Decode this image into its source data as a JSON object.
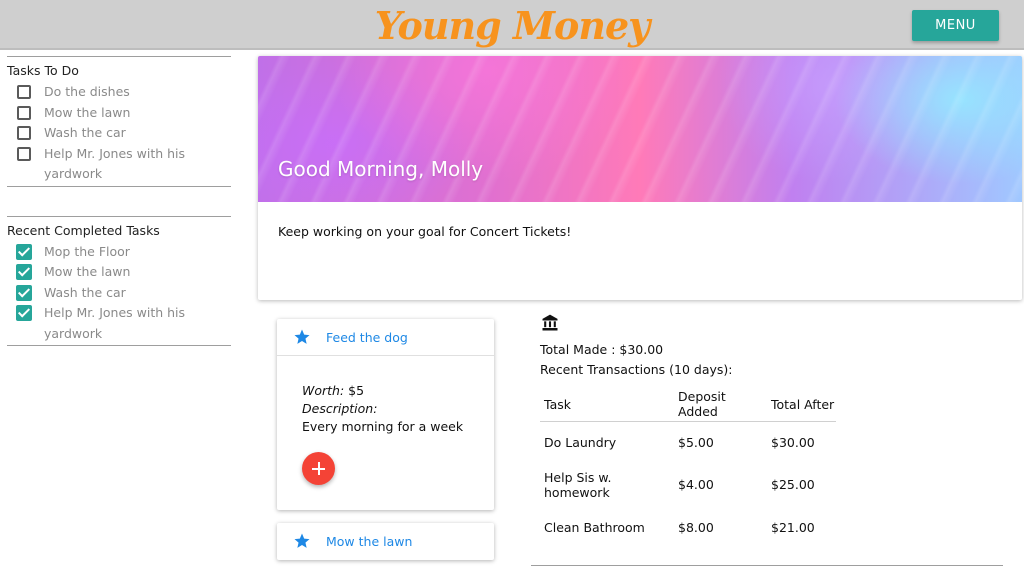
{
  "header": {
    "brand": "Young Money",
    "menu_label": "MENU",
    "brand_color": "#f7931e",
    "accent_color": "#26a69a"
  },
  "sidebar": {
    "todo": {
      "title": "Tasks To Do",
      "items": [
        {
          "label": "Do the dishes",
          "checked": false
        },
        {
          "label": "Mow the lawn",
          "checked": false
        },
        {
          "label": "Wash the car",
          "checked": false
        },
        {
          "label": "Help Mr. Jones with his yardwork",
          "checked": false
        }
      ]
    },
    "completed": {
      "title": "Recent Completed Tasks",
      "items": [
        {
          "label": "Mop the Floor",
          "checked": true
        },
        {
          "label": "Mow the lawn",
          "checked": true
        },
        {
          "label": "Wash the car",
          "checked": true
        },
        {
          "label": "Help Mr. Jones with his yardwork",
          "checked": true
        }
      ]
    }
  },
  "hero": {
    "greeting": "Good Morning, Molly",
    "message": "Keep working on your goal for Concert Tickets!"
  },
  "tasks": [
    {
      "title": "Feed the dog",
      "icon": "star-icon",
      "worth_label": "Worth:",
      "worth_value": "$5",
      "description_label": "Description:",
      "description": "Every morning for a week",
      "add_icon": "plus-icon"
    },
    {
      "title": "Mow the lawn",
      "icon": "star-icon"
    }
  ],
  "bank": {
    "icon": "bank-icon",
    "total_made": "Total Made : $30.00",
    "recent_label": "Recent Transactions (10 days):",
    "columns": [
      "Task",
      "Deposit Added",
      "Total After"
    ],
    "rows": [
      [
        "Do Laundry",
        "$5.00",
        "$30.00"
      ],
      [
        "Help Sis w. homework",
        "$4.00",
        "$25.00"
      ],
      [
        "Clean Bathroom",
        "$8.00",
        "$21.00"
      ]
    ]
  }
}
